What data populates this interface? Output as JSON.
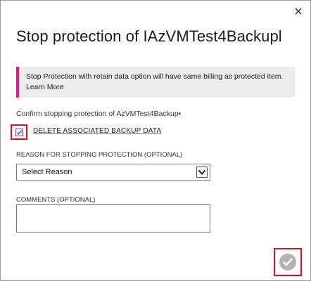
{
  "dialog": {
    "title": "Stop protection of IAzVMTest4Backupl",
    "info": {
      "message": "Stop Protection with retain data option will have same billing as protected item.",
      "learn_more": "Learn More"
    },
    "confirm_text": "Confirm stopping protection of AzVMTest4Backup•",
    "delete_checkbox": {
      "label": "DELETE ASSOCIATED BACKUP DATA",
      "checked": true
    },
    "reason": {
      "label": "REASON FOR STOPPING PROTECTION (OPTIONAL)",
      "selected": "Select Reason"
    },
    "comments": {
      "label": "COMMENTS (OPTIONAL)",
      "value": ""
    }
  },
  "icons": {
    "close": "close-icon",
    "checkmark": "checkmark-icon",
    "chevron": "chevron-down-icon"
  },
  "colors": {
    "accent_bar": "#e0197d",
    "highlight": "#d6141e",
    "checkbox": "#8a2fb8",
    "confirm_button": "#b3b3b3"
  }
}
